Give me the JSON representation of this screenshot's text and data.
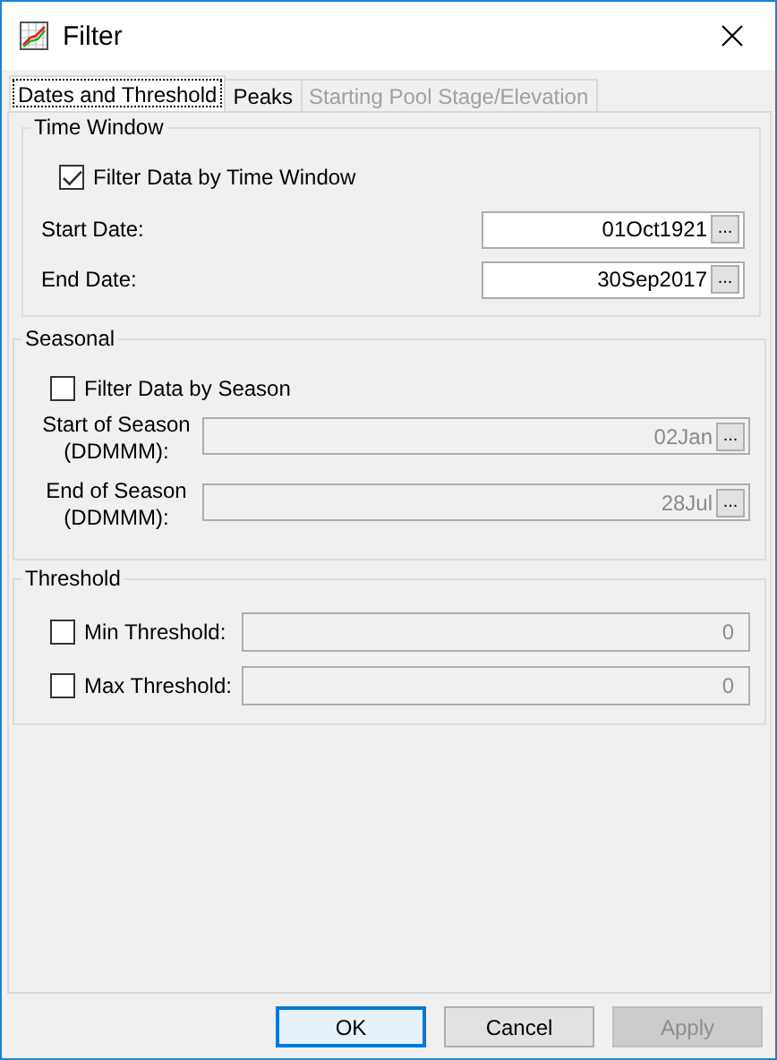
{
  "window": {
    "title": "Filter"
  },
  "tabs": [
    {
      "label": "Dates and Threshold",
      "selected": true,
      "disabled": false
    },
    {
      "label": "Peaks",
      "selected": false,
      "disabled": false
    },
    {
      "label": "Starting Pool Stage/Elevation",
      "selected": false,
      "disabled": true
    }
  ],
  "time_window": {
    "title": "Time Window",
    "checkbox": {
      "label": "Filter Data by Time Window",
      "checked": true
    },
    "fields": [
      {
        "label": "Start Date:",
        "value": "01Oct1921",
        "browse": "...",
        "disabled": false
      },
      {
        "label": "End Date:",
        "value": "30Sep2017",
        "browse": "...",
        "disabled": false
      }
    ]
  },
  "seasonal": {
    "title": "Seasonal",
    "checkbox": {
      "label": "Filter Data by Season",
      "checked": false
    },
    "fields": [
      {
        "label": "Start of Season (DDMMM):",
        "value": "02Jan",
        "browse": "...",
        "disabled": true
      },
      {
        "label": "End of Season (DDMMM):",
        "value": "28Jul",
        "browse": "...",
        "disabled": true
      }
    ]
  },
  "threshold": {
    "title": "Threshold",
    "rows": [
      {
        "label": "Min Threshold:",
        "checked": false,
        "value": "0",
        "disabled": true
      },
      {
        "label": "Max Threshold:",
        "checked": false,
        "value": "0",
        "disabled": true
      }
    ]
  },
  "buttons": [
    {
      "label": "OK",
      "default": true,
      "disabled": false
    },
    {
      "label": "Cancel",
      "default": false,
      "disabled": false
    },
    {
      "label": "Apply",
      "default": false,
      "disabled": true
    }
  ]
}
